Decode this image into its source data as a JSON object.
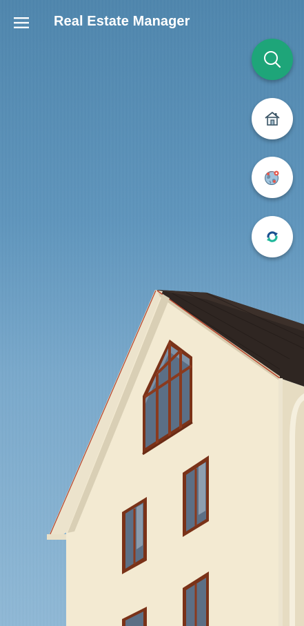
{
  "app_bar": {
    "title": "Real Estate Manager",
    "menu_icon": "hamburger-menu-icon"
  },
  "fabs": [
    {
      "icon": "search-icon",
      "color": "#1ea579"
    },
    {
      "icon": "home-icon",
      "color": "#ffffff"
    },
    {
      "icon": "globe-map-icon",
      "color": "#ffffff"
    },
    {
      "icon": "sync-icon",
      "color": "#ffffff"
    }
  ],
  "background": {
    "sky_color": "#5f95bc",
    "wall_color": "#f3ead3",
    "roof_color": "#2e2420",
    "window_frame_color": "#8a3a1e"
  }
}
